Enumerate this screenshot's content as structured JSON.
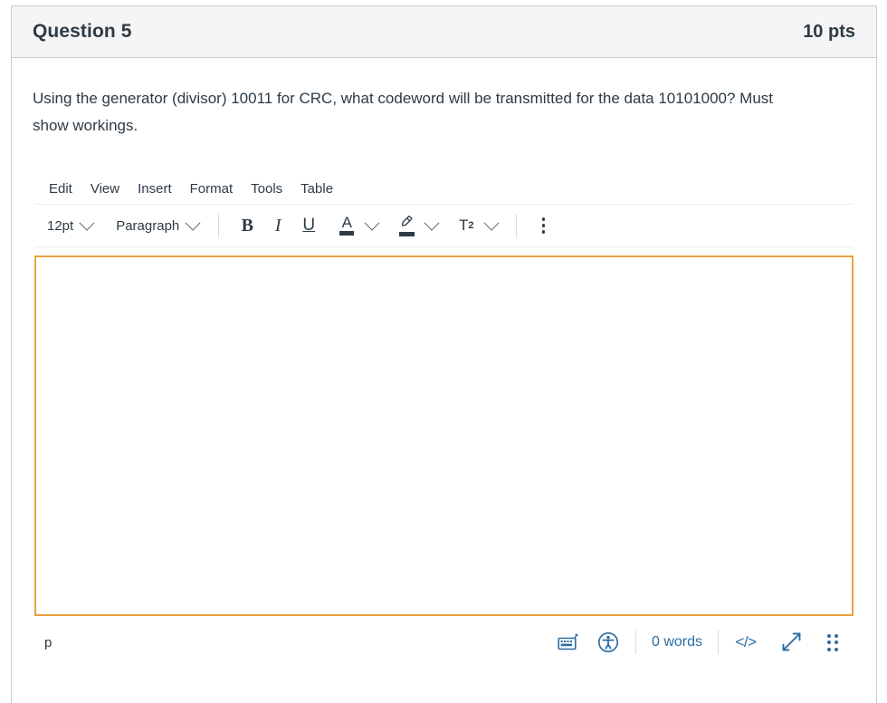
{
  "question": {
    "title": "Question 5",
    "points": "10 pts",
    "text": "Using the generator (divisor) 10011 for CRC, what codeword will be transmitted for the data 10101000? Must show workings."
  },
  "editor": {
    "menubar": [
      {
        "label": "Edit"
      },
      {
        "label": "View"
      },
      {
        "label": "Insert"
      },
      {
        "label": "Format"
      },
      {
        "label": "Tools"
      },
      {
        "label": "Table"
      }
    ],
    "toolbar": {
      "fontsize_value": "12pt",
      "blockformat_value": "Paragraph",
      "bold_label": "B",
      "italic_label": "I",
      "underline_label": "U",
      "textcolor_label": "A",
      "superscript_label": "T",
      "superscript_exponent": "2",
      "more_label": "More..."
    },
    "content": "",
    "statusbar": {
      "elementpath": "p",
      "wordcount": "0 words",
      "code_label": "</>",
      "keyboard_shortcuts_label": "Keyboard shortcuts",
      "accessibility_label": "Accessibility checker",
      "fullscreen_label": "Fullscreen",
      "resize_label": "Resize"
    }
  },
  "colors": {
    "focus_border": "#e8a33d",
    "header_bg": "#f5f5f5",
    "container_border": "#c7cdd1",
    "link_blue": "#2b6ca3",
    "text": "#2d3b45"
  }
}
